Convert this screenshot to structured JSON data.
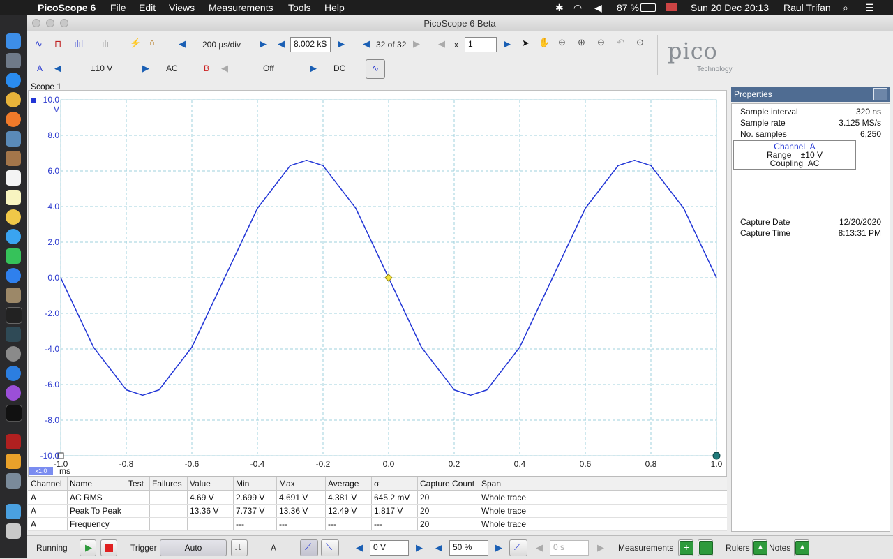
{
  "menubar": {
    "app_name": "PicoScope 6",
    "menus": [
      "File",
      "Edit",
      "Views",
      "Measurements",
      "Tools",
      "Help"
    ],
    "battery": "87 %",
    "datetime": "Sun 20 Dec  20:13",
    "user": "Raul Trifan"
  },
  "window": {
    "title": "PicoScope 6 Beta"
  },
  "toolbar": {
    "timebase": "200 µs/div",
    "samples": "8.002 kS",
    "buffer": "32 of 32",
    "zoom_prefix": "x",
    "zoom_value": "1",
    "channel_a": {
      "label": "A",
      "range": "±10 V",
      "coupling": "AC"
    },
    "channel_b": {
      "label": "B",
      "range": "Off",
      "coupling": "DC"
    }
  },
  "logo": {
    "brand": "pico",
    "sub": "Technology"
  },
  "scope": {
    "tab_label": "Scope 1",
    "y_unit": "V",
    "x_unit": "ms",
    "zoom_badge": "x1.0",
    "y_ticks": [
      "10.0",
      "8.0",
      "6.0",
      "4.0",
      "2.0",
      "0.0",
      "-2.0",
      "-4.0",
      "-6.0",
      "-8.0",
      "-10.0"
    ],
    "x_ticks": [
      "-1.0",
      "-0.8",
      "-0.6",
      "-0.4",
      "-0.2",
      "0.0",
      "0.2",
      "0.4",
      "0.6",
      "0.8",
      "1.0"
    ],
    "trace_color": "#2236d6",
    "trigger_marker_color": "#f2e23c"
  },
  "chart_data": {
    "type": "line",
    "xlabel": "ms",
    "ylabel": "V",
    "xlim": [
      -1.0,
      1.0
    ],
    "ylim": [
      -10.0,
      10.0
    ],
    "grid": true,
    "series": [
      {
        "color": "#2236d6",
        "x": [
          -1.0,
          -0.9,
          -0.8,
          -0.75,
          -0.7,
          -0.6,
          -0.5,
          -0.4,
          -0.3,
          -0.25,
          -0.2,
          -0.1,
          0.0,
          0.1,
          0.2,
          0.25,
          0.3,
          0.4,
          0.5,
          0.6,
          0.7,
          0.75,
          0.8,
          0.9,
          1.0
        ],
        "y": [
          0.0,
          -3.9,
          -6.3,
          -6.6,
          -6.3,
          -3.9,
          0.0,
          3.9,
          6.3,
          6.6,
          6.3,
          3.9,
          0.0,
          -3.9,
          -6.3,
          -6.6,
          -6.3,
          -3.9,
          0.0,
          3.9,
          6.3,
          6.6,
          6.3,
          3.9,
          0.0
        ]
      }
    ]
  },
  "measurements": {
    "headers": [
      "Channel",
      "Name",
      "Test",
      "Failures",
      "Value",
      "Min",
      "Max",
      "Average",
      "σ",
      "Capture Count",
      "Span"
    ],
    "rows": [
      [
        "A",
        "AC RMS",
        "",
        "",
        "4.69 V",
        "2.699 V",
        "4.691 V",
        "4.381 V",
        "645.2 mV",
        "20",
        "Whole trace"
      ],
      [
        "A",
        "Peak To Peak",
        "",
        "",
        "13.36 V",
        "7.737 V",
        "13.36 V",
        "12.49 V",
        "1.817 V",
        "20",
        "Whole trace"
      ],
      [
        "A",
        "Frequency",
        "",
        "",
        "",
        "---",
        "---",
        "---",
        "---",
        "20",
        "Whole trace"
      ]
    ]
  },
  "properties": {
    "title": "Properties",
    "sample_interval_label": "Sample interval",
    "sample_interval": "320 ns",
    "sample_rate_label": "Sample rate",
    "sample_rate": "3.125 MS/s",
    "num_samples_label": "No. samples",
    "num_samples": "6,250",
    "channel_label": "Channel",
    "channel": "A",
    "range_label": "Range",
    "range": "±10 V",
    "coupling_label": "Coupling",
    "coupling": "AC",
    "capture_date_label": "Capture Date",
    "capture_date": "12/20/2020",
    "capture_time_label": "Capture Time",
    "capture_time": "8:13:31 PM"
  },
  "statusbar": {
    "running": "Running",
    "trigger_label": "Trigger",
    "trigger_mode": "Auto",
    "trigger_channel": "A",
    "threshold": "0 V",
    "pretrigger": "50 %",
    "delay": "0 s",
    "measurements_label": "Measurements",
    "rulers_label": "Rulers",
    "notes_label": "Notes"
  }
}
